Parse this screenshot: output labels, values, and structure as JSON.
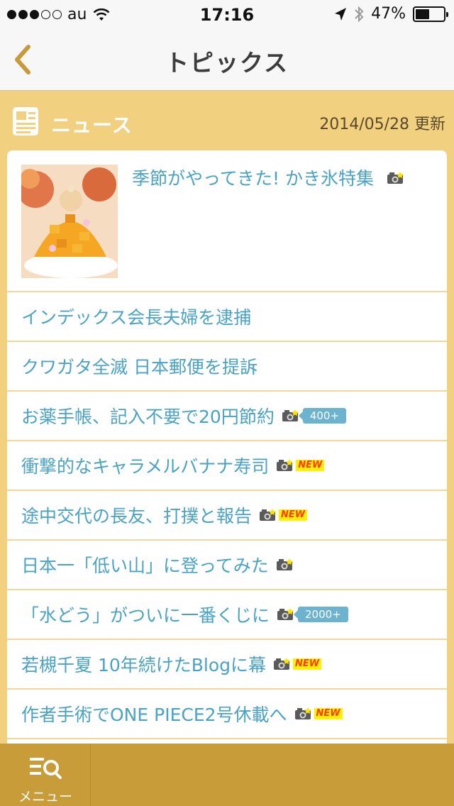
{
  "status_bar": {
    "carrier": "au",
    "time": "17:16",
    "battery": "47%",
    "signal_dots_filled": 3,
    "signal_dots_total": 5,
    "battery_level": 0.47
  },
  "nav": {
    "title": "トピックス"
  },
  "section": {
    "label": "ニュース",
    "updated": "2014/05/28 更新"
  },
  "featured": {
    "title": "季節がやってきた! かき氷特集"
  },
  "news_items": [
    {
      "title": "インデックス会長夫婦を逮捕",
      "camera": false,
      "badge": ""
    },
    {
      "title": "クワガタ全滅 日本郵便を提訴",
      "camera": false,
      "badge": ""
    },
    {
      "title": "お薬手帳、記入不要で20円節約",
      "camera": true,
      "badge": "400+",
      "badge_type": "count"
    },
    {
      "title": "衝撃的なキャラメルバナナ寿司",
      "camera": true,
      "badge": "NEW",
      "badge_type": "new"
    },
    {
      "title": "途中交代の長友、打撲と報告",
      "camera": true,
      "badge": "NEW",
      "badge_type": "new"
    },
    {
      "title": "日本一「低い山」に登ってみた",
      "camera": true,
      "badge": ""
    },
    {
      "title": "「水どう」がついに一番くじに",
      "camera": true,
      "badge": "2000+",
      "badge_type": "count"
    },
    {
      "title": "若槻千夏 10年続けたBlogに幕",
      "camera": true,
      "badge": "NEW",
      "badge_type": "new"
    },
    {
      "title": "作者手術でONE PIECE2号休載へ",
      "camera": true,
      "badge": "NEW",
      "badge_type": "new"
    }
  ],
  "tabbar": {
    "menu_label": "メニュー"
  },
  "colors": {
    "accent": "#c99c3a",
    "link": "#4aa3c4",
    "background": "#f1d07f"
  },
  "icons": [
    "back-chevron-icon",
    "news-icon",
    "camera-icon",
    "menu-search-icon",
    "wifi-icon",
    "location-icon",
    "bluetooth-icon",
    "battery-icon"
  ]
}
